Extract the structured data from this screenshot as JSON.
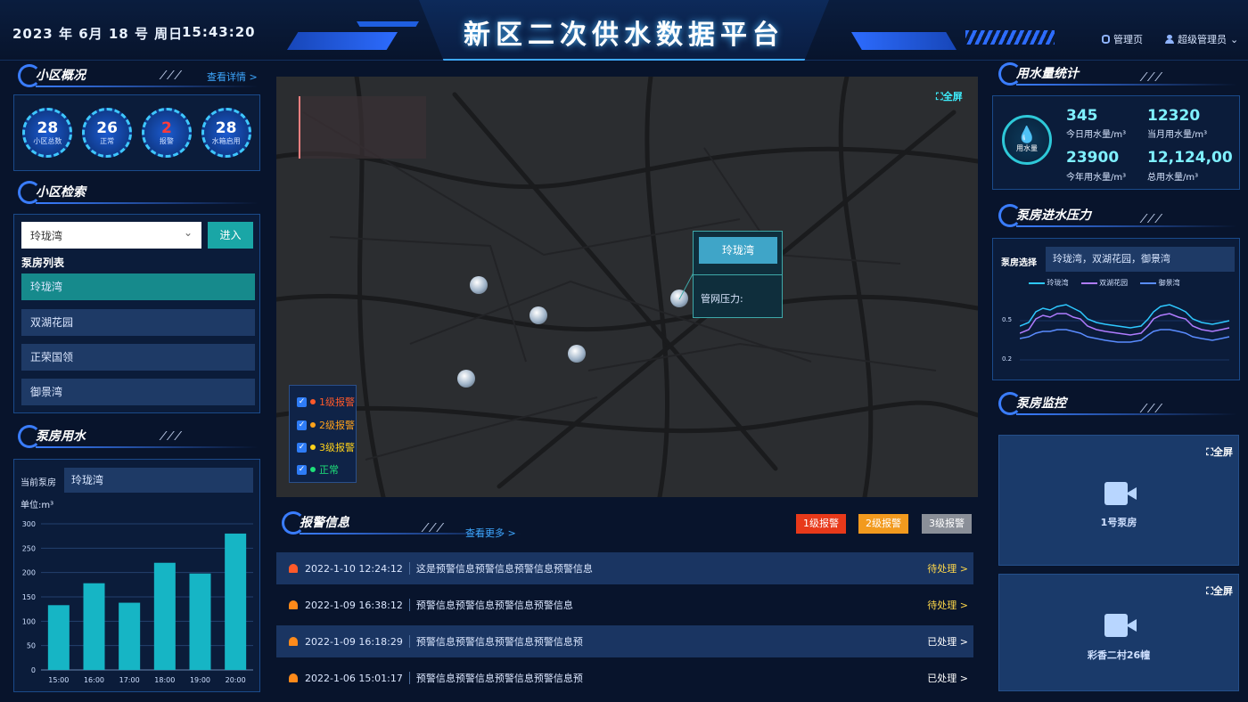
{
  "header": {
    "date": "2023 年 6月 18 号  周日",
    "time": "15:43:20",
    "title": "新区二次供水数据平台",
    "admin_page": "管理页",
    "user": "超级管理员"
  },
  "overview": {
    "title": "小区概况",
    "more": "查看详情 >",
    "stats": [
      {
        "value": "28",
        "label": "小区总数"
      },
      {
        "value": "26",
        "label": "正常"
      },
      {
        "value": "2",
        "label": "报警"
      },
      {
        "value": "28",
        "label": "水箱启用"
      }
    ]
  },
  "search": {
    "title": "小区检索",
    "selected": "玲珑湾",
    "enter": "进入",
    "list_title": "泵房列表",
    "items": [
      "玲珑湾",
      "双湖花园",
      "正荣国领",
      "御景湾"
    ]
  },
  "pump_usage": {
    "title": "泵房用水",
    "current_label": "当前泵房",
    "current_value": "玲珑湾",
    "unit": "单位:m³"
  },
  "chart_data": {
    "type": "bar",
    "categories": [
      "15:00",
      "16:00",
      "17:00",
      "18:00",
      "19:00",
      "20:00"
    ],
    "series": [
      {
        "values": [
          133,
          178,
          138,
          220,
          198,
          280
        ]
      }
    ],
    "ylabel": "单位:m³",
    "yticks": [
      0,
      50,
      100,
      150,
      200,
      250,
      300
    ],
    "ylim": [
      0,
      300
    ],
    "grid": true,
    "color": "#16b5c5"
  },
  "map": {
    "fullscreen": "全屏",
    "popup_title": "玲珑湾",
    "popup_field": "管网压力:",
    "legend": [
      {
        "label": "1级报警",
        "color": "#ff5a2a"
      },
      {
        "label": "2级报警",
        "color": "#ffa21a"
      },
      {
        "label": "3级报警",
        "color": "#ffd21a"
      },
      {
        "label": "正常",
        "color": "#1ee07a"
      }
    ]
  },
  "alarms": {
    "title": "报警信息",
    "more": "查看更多 >",
    "filters": [
      {
        "label": "1级报警",
        "color": "#e8391a"
      },
      {
        "label": "2级报警",
        "color": "#f29a1e"
      },
      {
        "label": "3级报警",
        "color": "#8a8f98"
      }
    ],
    "rows": [
      {
        "time": "2022-1-10 12:24:12",
        "msg": "这是预警信息预警信息预警信息预警信息",
        "status": "待处理 >",
        "color": "#ffd84a"
      },
      {
        "time": "2022-1-09 16:38:12",
        "msg": "预警信息预警信息预警信息预警信息",
        "status": "待处理 >",
        "color": "#ffd84a"
      },
      {
        "time": "2022-1-09 16:18:29",
        "msg": "预警信息预警信息预警信息预警信息预",
        "status": "已处理 >",
        "color": "#ffffff"
      },
      {
        "time": "2022-1-06 15:01:17",
        "msg": "预警信息预警信息预警信息预警信息预",
        "status": "已处理 >",
        "color": "#ffffff"
      }
    ]
  },
  "water": {
    "title": "用水量统计",
    "icon_label": "用水量",
    "items": [
      {
        "value": "345",
        "label": "今日用水量/m³"
      },
      {
        "value": "12320",
        "label": "当月用水量/m³"
      },
      {
        "value": "23900",
        "label": "今年用水量/m³"
      },
      {
        "value": "12,124,00",
        "label": "总用水量/m³"
      }
    ]
  },
  "pressure": {
    "title": "泵房进水压力",
    "select_label": "泵房选择",
    "select_value": "玲珑湾，双湖花园，御景湾",
    "legend": [
      {
        "label": "玲珑湾",
        "color": "#2ec8ff"
      },
      {
        "label": "双湖花园",
        "color": "#b07cff"
      },
      {
        "label": "御景湾",
        "color": "#5a8cff"
      }
    ],
    "yticks": [
      "0.5",
      "0.2"
    ]
  },
  "monitor": {
    "title": "泵房监控",
    "videos": [
      {
        "name": "1号泵房",
        "fullscreen": "全屏"
      },
      {
        "name": "彩香二村26幢",
        "fullscreen": "全屏"
      }
    ]
  }
}
